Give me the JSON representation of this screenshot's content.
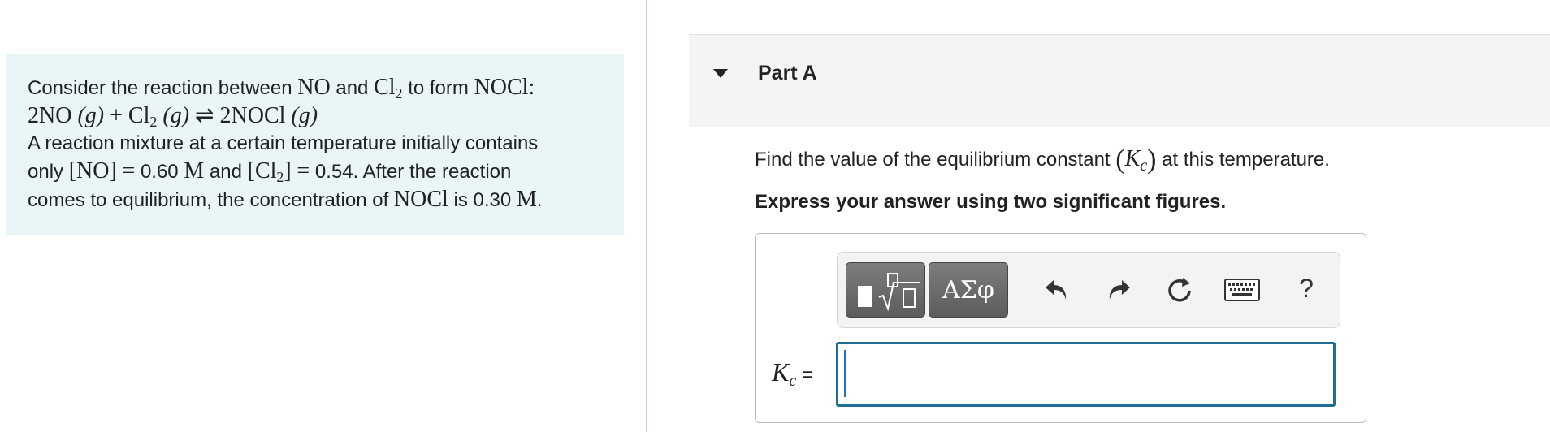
{
  "problem": {
    "intro": "Consider the reaction between",
    "reactant1": "NO",
    "and": "and",
    "reactant2": "Cl",
    "reactant2_sub": "2",
    "to_form": "to form",
    "product": "NOCl",
    "colon": ":",
    "equation": {
      "lhs1": "2NO",
      "phase1": "(g)",
      "plus": "+",
      "lhs2": "Cl",
      "lhs2_sub": "2",
      "phase2": "(g)",
      "arrow": "⇌",
      "rhs": "2NOCl",
      "phase3": "(g)"
    },
    "line3": "A reaction mixture at a certain temperature initially contains",
    "line4_only": "only",
    "no_conc": "[NO]",
    "eq1": "=",
    "no_value": "0.60",
    "unit_m": "M",
    "and2": "and",
    "cl2_conc_open": "[Cl",
    "cl2_conc_sub": "2",
    "cl2_conc_close": "]",
    "eq2": "=",
    "cl2_value": "0.54",
    "after": ". After the reaction",
    "line5": "comes to equilibrium, the concentration of",
    "nocl": "NOCl",
    "is": "is",
    "nocl_value": "0.30",
    "unit_m2": "M",
    "period": "."
  },
  "part": {
    "title": "Part A",
    "question_pre": "Find the value of the equilibrium constant",
    "kc_symbol": "K",
    "kc_sub": "c",
    "question_post": "at this temperature.",
    "instruction": "Express your answer using two significant figures."
  },
  "toolbar": {
    "templates_icon": "templates-icon",
    "symbols_label": "ΑΣφ",
    "undo_icon": "undo-icon",
    "redo_icon": "redo-icon",
    "reset_icon": "reset-icon",
    "keyboard_icon": "keyboard-icon",
    "help_label": "?"
  },
  "answer": {
    "label_symbol": "K",
    "label_sub": "c",
    "label_eq": "=",
    "value": ""
  },
  "colors": {
    "problem_bg": "#e9f5f7",
    "input_border": "#1f6f92",
    "button_gray": "#666666"
  }
}
